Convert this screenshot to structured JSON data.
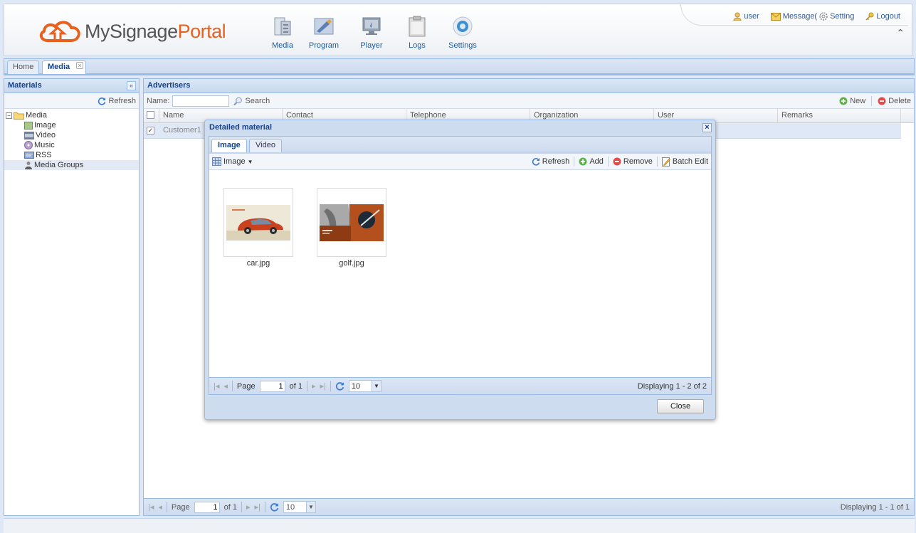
{
  "header": {
    "logo_part1": "MySignage",
    "logo_part2": "Portal",
    "nav": [
      {
        "label": "Media",
        "icon": "media-icon"
      },
      {
        "label": "Program",
        "icon": "program-icon"
      },
      {
        "label": "Player",
        "icon": "player-icon"
      },
      {
        "label": "Logs",
        "icon": "logs-icon"
      },
      {
        "label": "Settings",
        "icon": "settings-icon"
      }
    ],
    "user": "user",
    "message": "Message(",
    "setting": "Setting",
    "logout": "Logout"
  },
  "tabs": {
    "home": "Home",
    "media": "Media",
    "media_close": "×"
  },
  "left_panel": {
    "title": "Materials",
    "collapse": "«",
    "refresh": "Refresh",
    "tree": {
      "root": "Media",
      "children": [
        "Image",
        "Video",
        "Music",
        "RSS",
        "Media Groups"
      ]
    }
  },
  "advertisers": {
    "title": "Advertisers",
    "name_label": "Name:",
    "name_value": "",
    "search": "Search",
    "new": "New",
    "delete": "Delete",
    "columns": [
      "Name",
      "Contact",
      "Telephone",
      "Organization",
      "User",
      "Remarks"
    ],
    "rows": [
      {
        "name": "Customer1",
        "checked": true
      }
    ],
    "pager": {
      "page_label": "Page",
      "page": "1",
      "of": "of 1",
      "page_size": "10",
      "display": "Displaying 1 - 1 of 1"
    }
  },
  "dialog": {
    "title": "Detailed material",
    "close_x": "×",
    "tabs": [
      "Image",
      "Video"
    ],
    "type_menu": "Image",
    "refresh": "Refresh",
    "add": "Add",
    "remove": "Remove",
    "batch_edit": "Batch Edit",
    "items": [
      {
        "caption": "car.jpg"
      },
      {
        "caption": "golf.jpg"
      }
    ],
    "pager": {
      "page_label": "Page",
      "page": "1",
      "of": "of 1",
      "page_size": "10",
      "display": "Displaying 1 - 2 of 2"
    },
    "close_button": "Close"
  },
  "colors": {
    "accent": "#15428b",
    "logo_orange": "#e8601d",
    "panel_border": "#99bbe8"
  }
}
